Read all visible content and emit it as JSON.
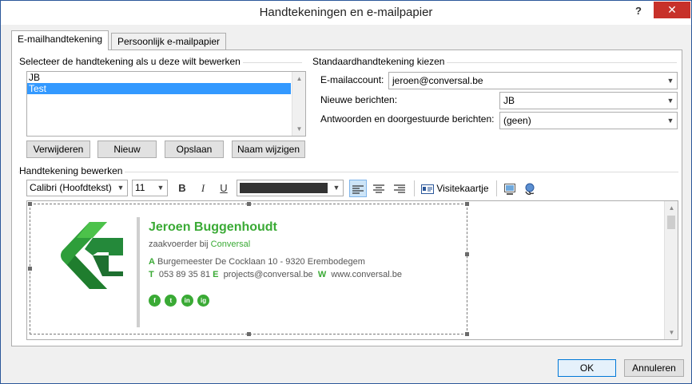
{
  "window": {
    "title": "Handtekeningen en e-mailpapier",
    "help": "?",
    "close": "✕"
  },
  "tabs": [
    {
      "label": "E-mailhandtekening"
    },
    {
      "label": "Persoonlijk e-mailpapier"
    }
  ],
  "select_group": {
    "label": "Selecteer de handtekening als u deze wilt bewerken",
    "items": [
      "JB",
      "Test"
    ],
    "selected_index": 1
  },
  "buttons": {
    "delete": "Verwijderen",
    "new": "Nieuw",
    "save": "Opslaan",
    "rename": "Naam wijzigen",
    "ok": "OK",
    "cancel": "Annuleren"
  },
  "default_group": {
    "label": "Standaardhandtekening kiezen",
    "email_account_label": "E-mailaccount:",
    "email_account_value": "jeroen@conversal.be",
    "new_messages_label": "Nieuwe berichten:",
    "new_messages_value": "JB",
    "replies_label": "Antwoorden en doorgestuurde berichten:",
    "replies_value": "(geen)"
  },
  "edit_group": {
    "label": "Handtekening bewerken",
    "font": "Calibri (Hoofdtekst)",
    "size": "11",
    "bold": "B",
    "italic": "I",
    "underline": "U",
    "font_color": "#333333",
    "business_card": "Visitekaartje"
  },
  "signature": {
    "name": "Jeroen Buggenhoudt",
    "role": "zaakvoerder bij",
    "company": "Conversal",
    "address_prefix": "A",
    "address": "Burgemeester De Cocklaan 10 - 9320 Erembodegem",
    "phone_prefix": "T",
    "phone": "053 89 35 81",
    "email_prefix": "E",
    "email": "projects@conversal.be",
    "web_prefix": "W",
    "web": "www.conversal.be",
    "social": [
      "f",
      "t",
      "in",
      "ig"
    ],
    "accent_color": "#3aaa35"
  }
}
